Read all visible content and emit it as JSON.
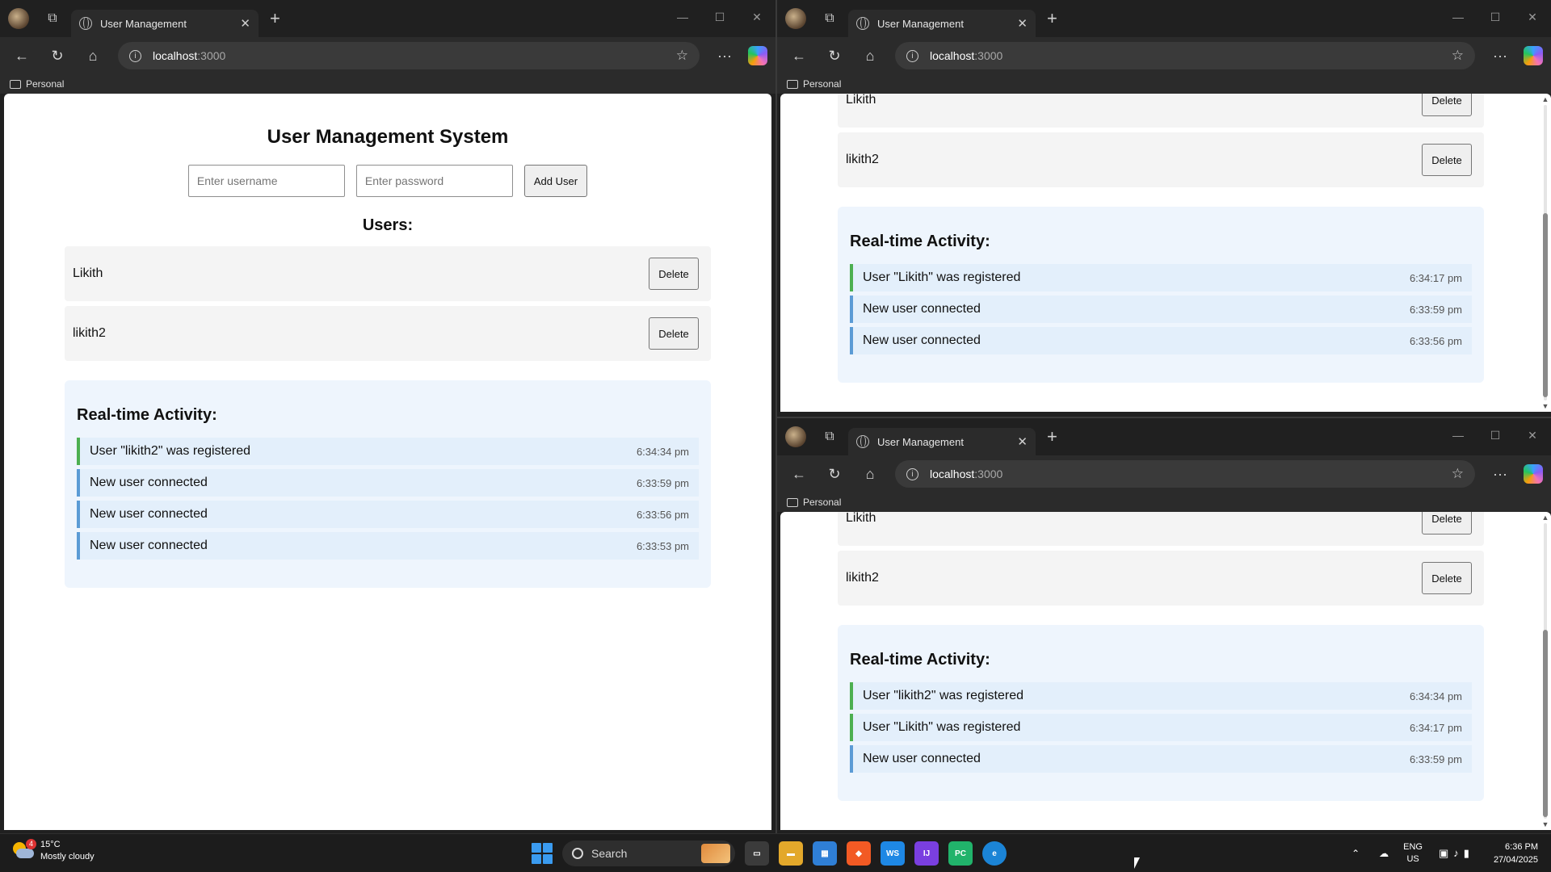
{
  "browser": {
    "tab_title": "User Management",
    "tab_close": "✕",
    "new_tab": "+",
    "url_host": "localhost",
    "url_port": ":3000",
    "favorites_folder": "Personal",
    "controls": {
      "minimize": "—",
      "maximize": "☐",
      "close": "✕"
    },
    "icons": {
      "back": "arrow-left-icon",
      "reload": "refresh-icon",
      "home": "home-icon",
      "more": "ellipsis-icon"
    }
  },
  "app": {
    "title": "User Management System",
    "username_placeholder": "Enter username",
    "password_placeholder": "Enter password",
    "add_button": "Add User",
    "users_heading": "Users:",
    "delete_label": "Delete",
    "activity_heading": "Real-time Activity:"
  },
  "windows": {
    "left": {
      "users": [
        "Likith",
        "likith2"
      ],
      "activity": [
        {
          "text": "User \"likith2\" was registered",
          "time": "6:34:34 pm",
          "type": "registered"
        },
        {
          "text": "New user connected",
          "time": "6:33:59 pm",
          "type": "connected"
        },
        {
          "text": "New user connected",
          "time": "6:33:56 pm",
          "type": "connected"
        },
        {
          "text": "New user connected",
          "time": "6:33:53 pm",
          "type": "connected"
        }
      ]
    },
    "top_right": {
      "users": [
        "Likith",
        "likith2"
      ],
      "activity": [
        {
          "text": "User \"Likith\" was registered",
          "time": "6:34:17 pm",
          "type": "registered"
        },
        {
          "text": "New user connected",
          "time": "6:33:59 pm",
          "type": "connected"
        },
        {
          "text": "New user connected",
          "time": "6:33:56 pm",
          "type": "connected"
        }
      ]
    },
    "bottom_right": {
      "users": [
        "Likith",
        "likith2"
      ],
      "activity": [
        {
          "text": "User \"likith2\" was registered",
          "time": "6:34:34 pm",
          "type": "registered"
        },
        {
          "text": "User \"Likith\" was registered",
          "time": "6:34:17 pm",
          "type": "registered"
        },
        {
          "text": "New user connected",
          "time": "6:33:59 pm",
          "type": "connected"
        }
      ]
    }
  },
  "colors": {
    "registered_border": "#4caf50",
    "connected_border": "#5b9bd5",
    "activity_bg": "#eef5fd"
  },
  "taskbar": {
    "weather_temp": "15°C",
    "weather_desc": "Mostly cloudy",
    "weather_badge": "4",
    "search_label": "Search",
    "lang_primary": "ENG",
    "lang_secondary": "US",
    "time": "6:36 PM",
    "date": "27/04/2025",
    "apps": [
      "task-view",
      "file-explorer",
      "store",
      "brave",
      "webstorm",
      "intellij",
      "pycharm",
      "edge"
    ]
  }
}
